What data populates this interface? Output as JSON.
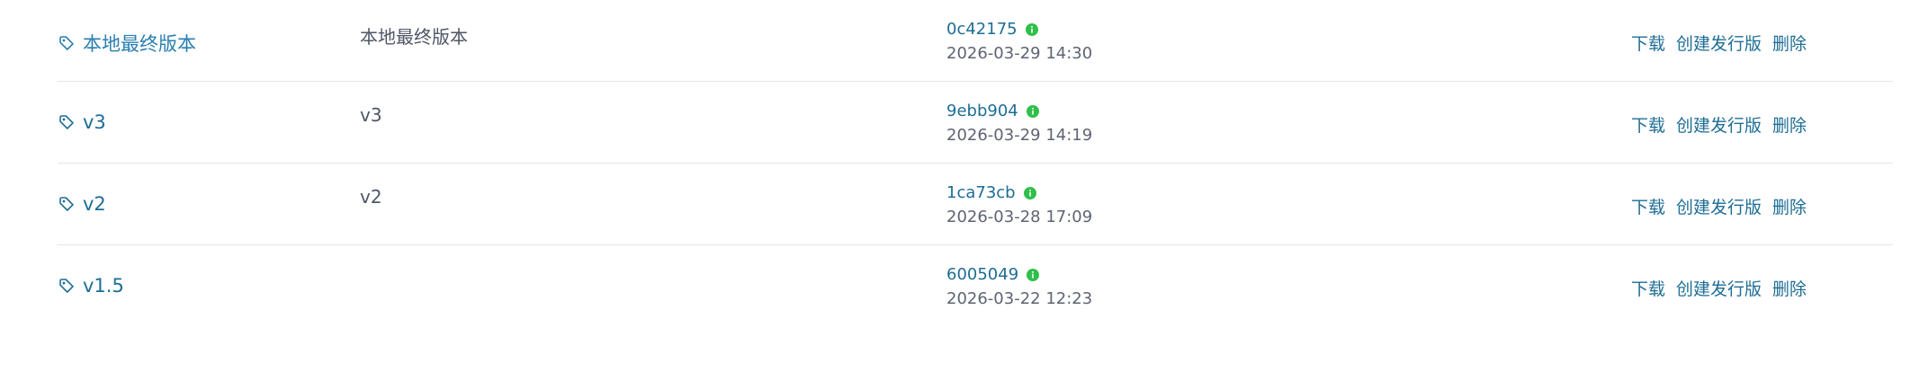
{
  "tags": [
    {
      "name": "本地最终版本",
      "description": "本地最终版本",
      "commit": "0c42175",
      "date": "2026-03-29 14:30",
      "actions": {
        "download": "下载",
        "create_release": "创建发行版",
        "delete": "删除"
      }
    },
    {
      "name": "v3",
      "description": "v3",
      "commit": "9ebb904",
      "date": "2026-03-29 14:19",
      "actions": {
        "download": "下载",
        "create_release": "创建发行版",
        "delete": "删除"
      }
    },
    {
      "name": "v2",
      "description": "v2",
      "commit": "1ca73cb",
      "date": "2026-03-28 17:09",
      "actions": {
        "download": "下载",
        "create_release": "创建发行版",
        "delete": "删除"
      }
    },
    {
      "name": "v1.5",
      "description": "",
      "commit": "6005049",
      "date": "2026-03-22 12:23",
      "actions": {
        "download": "下载",
        "create_release": "创建发行版",
        "delete": "删除"
      }
    }
  ],
  "colors": {
    "link": "#1e6d94",
    "primary_tag_link": "#2a7fb0",
    "verified_green": "#2fbf4a",
    "divider": "#e3e5ea"
  },
  "icons": {
    "tag": "tag-icon",
    "verified": "verified-info-icon"
  }
}
